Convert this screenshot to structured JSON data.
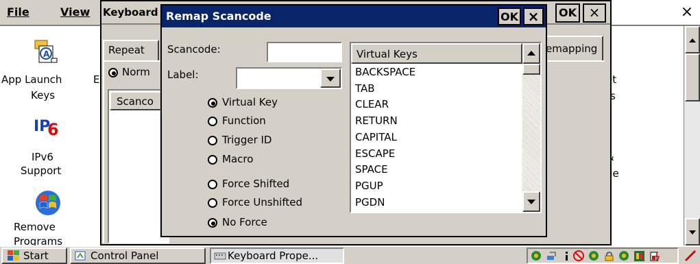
{
  "menu": {
    "file": "File",
    "view": "View"
  },
  "desktop_icons": [
    {
      "label": "App Launch Keys",
      "line1": "App Launch",
      "line2": "Keys",
      "icon": "app-launch-icon"
    },
    {
      "label": "IPv6 Support",
      "line1": "IPv6",
      "line2": "Support",
      "icon": "ipv6-icon"
    },
    {
      "label": "Remove Programs",
      "line1": "Remove",
      "line2": "Programs",
      "icon": "windows-flag-icon"
    }
  ],
  "partial_cp_letter": "E",
  "keyboard_window": {
    "title": "Keyboard",
    "tab_repeat": "Repeat",
    "tab_remapping": "emapping",
    "radio_normal": "Norm",
    "list_header": "Scanco",
    "ok": "OK",
    "close": "×"
  },
  "background_fragments": {
    "line1": "et",
    "line2": "s",
    "line3": "&",
    "line4": "ge",
    "line5": "r"
  },
  "outer_close": "×",
  "dialog": {
    "title": "Remap Scancode",
    "ok": "OK",
    "close": "×",
    "scancode_label": "Scancode:",
    "scancode_value": "",
    "label_label": "Label:",
    "label_value": "",
    "radios_type": [
      {
        "label": "Virtual Key",
        "selected": true
      },
      {
        "label": "Function",
        "selected": false
      },
      {
        "label": "Trigger ID",
        "selected": false
      },
      {
        "label": "Macro",
        "selected": false
      }
    ],
    "radios_force": [
      {
        "label": "Force Shifted",
        "selected": false
      },
      {
        "label": "Force Unshifted",
        "selected": false
      },
      {
        "label": "No Force",
        "selected": true
      }
    ],
    "list_header": "Virtual Keys",
    "virtual_keys": [
      "BACKSPACE",
      "TAB",
      "CLEAR",
      "RETURN",
      "CAPITAL",
      "ESCAPE",
      "SPACE",
      "PGUP",
      "PGDN"
    ]
  },
  "taskbar": {
    "start": "Start",
    "items": [
      "Control Panel",
      "Keyboard Prope..."
    ]
  },
  "colors": {
    "title_bar": "#0a246a",
    "face": "#d4d0c8"
  }
}
